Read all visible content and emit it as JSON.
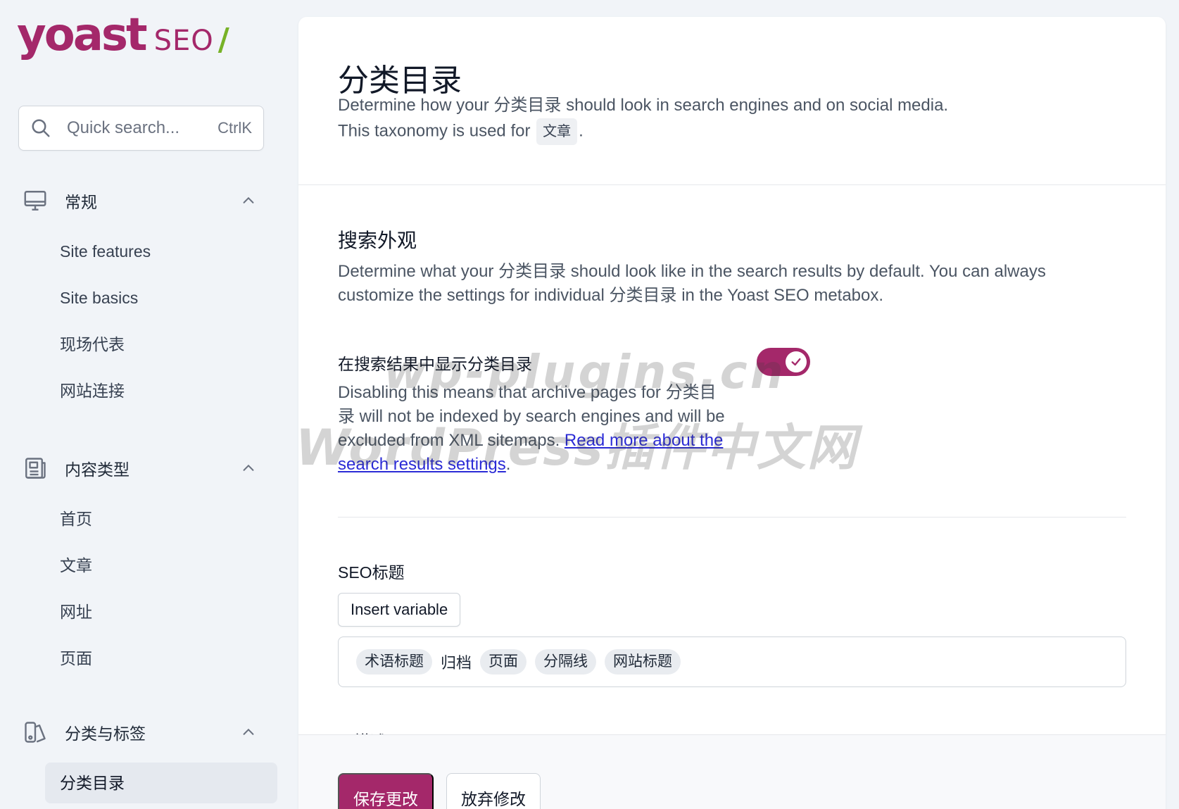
{
  "brand": {
    "logo_word": "yoast",
    "logo_seo": "SEO",
    "logo_slash": "/",
    "accent": "#a4286a",
    "slash_color": "#77b227"
  },
  "search": {
    "placeholder": "Quick search...",
    "shortcut": "CtrlK",
    "icon": "search-icon"
  },
  "sidebar": {
    "groups": [
      {
        "label": "常规",
        "icon": "monitor-icon",
        "items": [
          "Site features",
          "Site basics",
          "现场代表",
          "网站连接"
        ]
      },
      {
        "label": "内容类型",
        "icon": "document-icon",
        "items": [
          "首页",
          "文章",
          "网址",
          "页面"
        ]
      },
      {
        "label": "分类与标签",
        "icon": "tag-icon",
        "items": [
          "分类目录"
        ],
        "active_item": "分类目录"
      }
    ]
  },
  "header": {
    "title": "分类目录",
    "description_line1": "Determine how your 分类目录 should look in search engines and on social media.",
    "description_line2_prefix": "This taxonomy is used for",
    "post_type_pill": "文章",
    "description_line2_suffix": "."
  },
  "search_appearance": {
    "title": "搜索外观",
    "description": "Determine what your 分类目录 should look like in the search results by default. You can always customize the settings for individual 分类目录 in the Yoast SEO metabox.",
    "toggle": {
      "label": "在搜索结果中显示分类目录",
      "enabled": true,
      "description": "Disabling this means that archive pages for 分类目录 will not be indexed by search engines and will be excluded from XML sitemaps.",
      "link_text": "Read more about the search results settings",
      "link_suffix": "."
    },
    "seo_title": {
      "label": "SEO标题",
      "insert_button": "Insert variable",
      "tokens": [
        {
          "text": "术语标题",
          "chip": true
        },
        {
          "text": "归档",
          "chip": false
        },
        {
          "text": "页面",
          "chip": true
        },
        {
          "text": "分隔线",
          "chip": true
        },
        {
          "text": "网站标题",
          "chip": true
        }
      ]
    },
    "next_label_partial": "元描述"
  },
  "footer": {
    "save_label": "保存更改",
    "discard_label": "放弃修改"
  },
  "watermark": {
    "line1": "wp-plugins.cn",
    "line2": "WordPress插件中文网"
  }
}
